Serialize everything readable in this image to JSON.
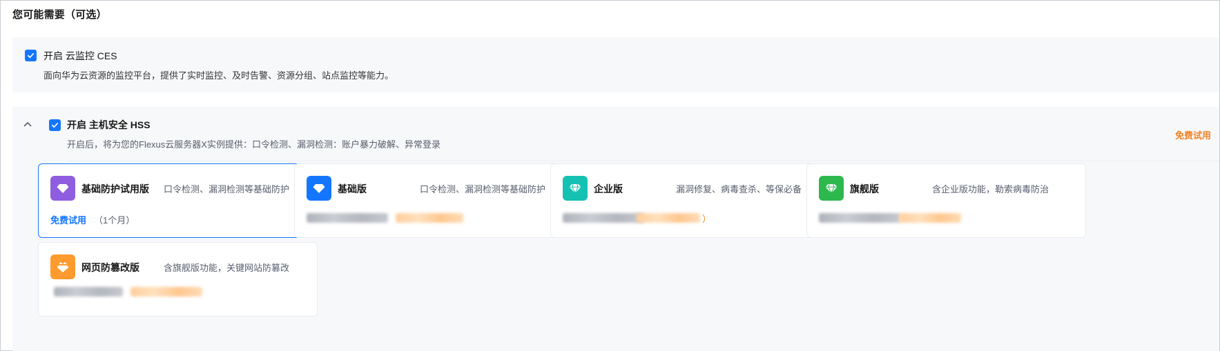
{
  "section_title": "您可能需要（可选）",
  "ces": {
    "checked": true,
    "title": "开启 云监控 CES",
    "description": "面向华为云资源的监控平台，提供了实时监控、及时告警、资源分组、站点监控等能力。"
  },
  "hss": {
    "checked": true,
    "expanded": true,
    "title": "开启 主机安全 HSS",
    "description": "开启后，将为您的Flexus云服务器X实例提供：口令检测、漏洞检测：账户暴力破解、异常登录",
    "free_trial_label": "免费试用",
    "editions": [
      {
        "name": "基础防护试用版",
        "feature": "口令检测、漏洞检测等基础防护",
        "icon": "diamond-icon",
        "icon_color": "#8f5ddf",
        "selected": true,
        "trial_label": "免费试用",
        "period": "（1个月）"
      },
      {
        "name": "基础版",
        "feature": "口令检测、漏洞检测等基础防护",
        "icon": "diamond-icon",
        "icon_color": "#1476ff",
        "selected": false
      },
      {
        "name": "企业版",
        "feature": "漏洞修复、病毒查杀、等保必备",
        "icon": "gem-icon",
        "icon_color": "#14c1b2",
        "selected": false,
        "price_suffix": "）"
      },
      {
        "name": "旗舰版",
        "feature": "含企业版功能，勒索病毒防治",
        "icon": "gem-icon",
        "icon_color": "#2db84d",
        "selected": false
      },
      {
        "name": "网页防篡改版",
        "feature": "含旗舰版功能，关键网站防篡改",
        "icon": "crown-diamond-icon",
        "icon_color": "#ff9a2e",
        "selected": false
      }
    ]
  },
  "colors": {
    "primary": "#1476ff",
    "accent_orange": "#f58220",
    "block_bg": "#f7f8fa"
  }
}
